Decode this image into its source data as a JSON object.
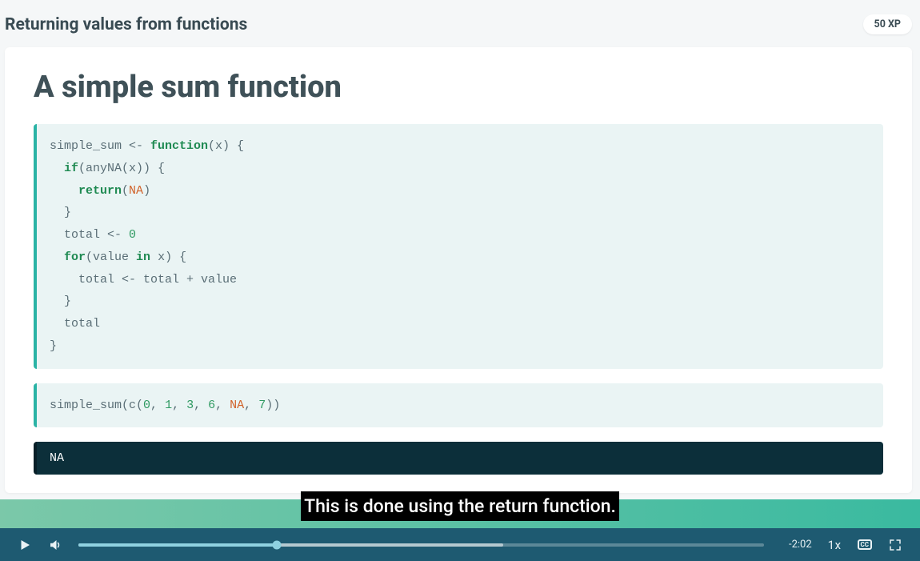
{
  "header": {
    "title": "Returning values from functions",
    "xp": "50 XP"
  },
  "slide": {
    "title": "A simple sum function",
    "code1": {
      "l1a": "simple_sum <- ",
      "l1b": "function",
      "l1c": "(x) {",
      "l2a": "  ",
      "l2b": "if",
      "l2c": "(anyNA(x)) {",
      "l3a": "    ",
      "l3b": "return",
      "l3c": "(",
      "l3d": "NA",
      "l3e": ")",
      "l4": "  }",
      "l5a": "  total <- ",
      "l5b": "0",
      "l6a": "  ",
      "l6b": "for",
      "l6c": "(value ",
      "l6d": "in",
      "l6e": " x) {",
      "l7": "    total <- total + value",
      "l8": "  }",
      "l9": "  total",
      "l10": "}"
    },
    "code2": {
      "a": "simple_sum(c(",
      "n0": "0",
      "c1": ", ",
      "n1": "1",
      "c2": ", ",
      "n3": "3",
      "c3": ", ",
      "n6": "6",
      "c4": ", ",
      "na": "NA",
      "c5": ", ",
      "n7": "7",
      "end": "))"
    },
    "output": "NA"
  },
  "caption": "This is done using the return function.",
  "player": {
    "played_pct": 29,
    "buffered_pct": 62,
    "time_remaining": "-2:02",
    "speed": "1x",
    "cc_label": "CC"
  }
}
